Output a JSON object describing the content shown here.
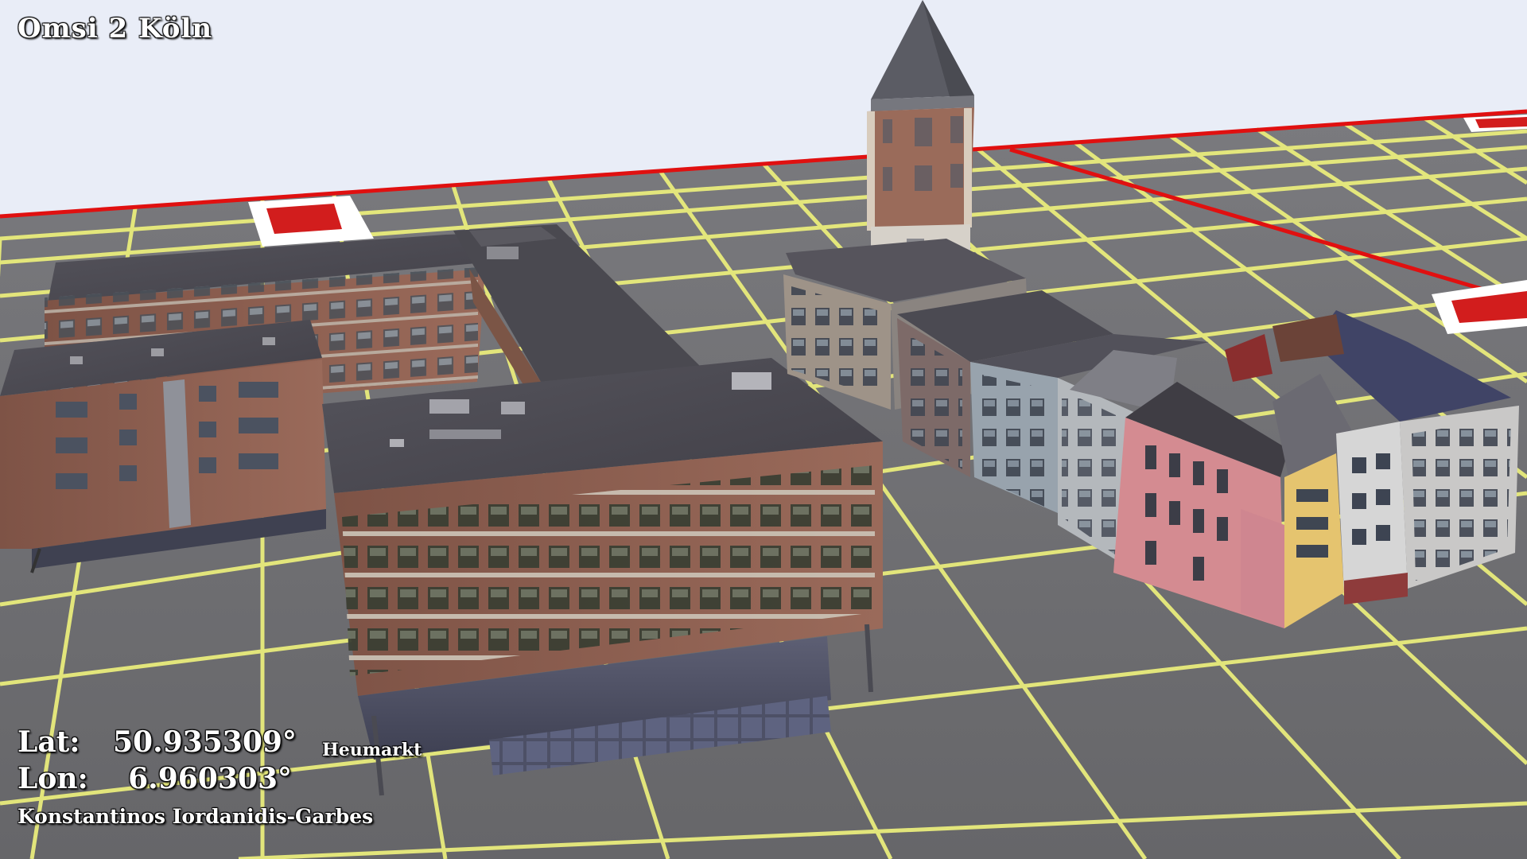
{
  "title": "Omsi 2 Köln",
  "coordinates": {
    "lat_label": "Lat:",
    "lat_value": "50.935309°",
    "lon_label": "Lon:",
    "lon_value": "6.960303°"
  },
  "location_name": "Heumarkt",
  "author": "Konstantinos Iordanidis-Garbes",
  "colors": {
    "sky": "#e9edf7",
    "ground": "#6d6d71",
    "grid_line": "#e9ec7c",
    "border_line": "#e01010",
    "roof": "#4c4a52",
    "brick": "#8a5a4c",
    "pink_facade": "#d88a90",
    "yellow_facade": "#e5c46f",
    "white_facade": "#cfcfcf",
    "tower_roof": "#595a62"
  },
  "icons": {
    "marker_icon": "red-white-tile"
  }
}
